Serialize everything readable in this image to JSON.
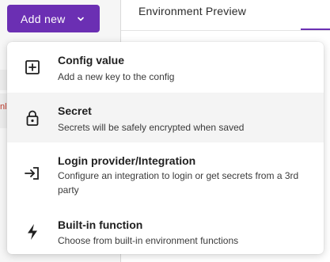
{
  "toolbar": {
    "add_new_label": "Add new"
  },
  "header": {
    "tab_label": "Environment Preview"
  },
  "background": {
    "clipped_text": "nl"
  },
  "menu": {
    "items": [
      {
        "title": "Config value",
        "description": "Add a new key to the config",
        "icon": "plus-square-icon"
      },
      {
        "title": "Secret",
        "description": "Secrets will be safely encrypted when saved",
        "icon": "lock-icon"
      },
      {
        "title": "Login provider/Integration",
        "description": "Configure an integration to login or get secrets from a 3rd party",
        "icon": "login-arrow-icon"
      },
      {
        "title": "Built-in function",
        "description": "Choose from built-in environment functions",
        "icon": "lightning-icon"
      }
    ]
  },
  "colors": {
    "accent": "#6b2fb3",
    "hover_bg": "#f4f4f4"
  }
}
